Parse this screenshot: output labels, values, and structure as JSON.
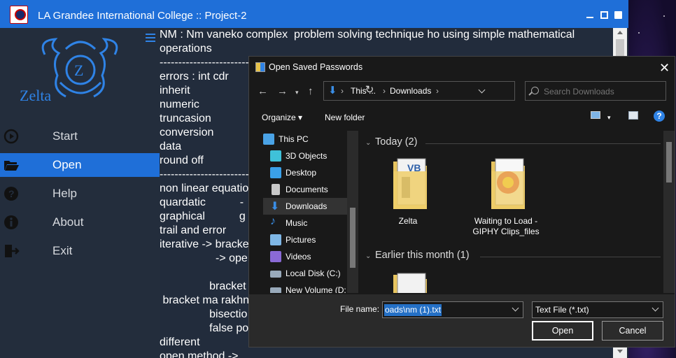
{
  "app": {
    "title": "LA Grandee International College :: Project-2",
    "brand": "Zelta",
    "colors": {
      "accent": "#1f6fd8",
      "sidebar": "#232d3c"
    }
  },
  "sidebar": {
    "items": [
      {
        "label": "Start",
        "icon": "play-circle-icon"
      },
      {
        "label": "Open",
        "icon": "folder-open-icon",
        "active": true
      },
      {
        "label": "Help",
        "icon": "help-circle-icon"
      },
      {
        "label": "About",
        "icon": "info-circle-icon"
      },
      {
        "label": "Exit",
        "icon": "exit-door-icon"
      }
    ]
  },
  "editor": {
    "lines": [
      "NM : Nm vaneko complex  problem solving technique ho using simple mathematical",
      "operations",
      "----------------------------------------",
      "errors : int cdr",
      "inherit",
      "numeric",
      "truncasion",
      "conversion",
      "data",
      "round off",
      "----------------------------------------",
      "non linear equatio",
      "quardatic           -",
      "graphical           g",
      "trail and error",
      "iterative -> bracke",
      "                  -> ope",
      "",
      "                bracket",
      " bracket ma rakhn",
      "                bisectio",
      "                false po",
      "different",
      "open method ->"
    ]
  },
  "dialog": {
    "title": "Open Saved Passwords",
    "breadcrumb": [
      "This ...",
      "Downloads"
    ],
    "search_placeholder": "Search Downloads",
    "organize_label": "Organize",
    "new_folder_label": "New folder",
    "tree": [
      {
        "label": "This PC",
        "icon": "computer-icon",
        "color": "#4aa3e6"
      },
      {
        "label": "3D Objects",
        "icon": "cube-icon",
        "color": "#3fc1d9"
      },
      {
        "label": "Desktop",
        "icon": "desktop-icon",
        "color": "#3aa0e8"
      },
      {
        "label": "Documents",
        "icon": "document-icon",
        "color": "#c8c8c8"
      },
      {
        "label": "Downloads",
        "icon": "download-arrow-icon",
        "color": "#3a8ee6",
        "selected": true
      },
      {
        "label": "Music",
        "icon": "music-note-icon",
        "color": "#3a8ee6"
      },
      {
        "label": "Pictures",
        "icon": "picture-icon",
        "color": "#7fb7e6"
      },
      {
        "label": "Videos",
        "icon": "video-icon",
        "color": "#8a6ad6"
      },
      {
        "label": "Local Disk (C:)",
        "icon": "disk-icon",
        "color": "#9ab"
      },
      {
        "label": "New Volume (D:",
        "icon": "disk-icon",
        "color": "#9ab"
      }
    ],
    "groups": [
      {
        "title": "Today (2)",
        "files": [
          {
            "label": "Zelta",
            "icon": "folder-icon"
          },
          {
            "label": "Waiting to Load - GIPHY Clips_files",
            "icon": "folder-icon"
          }
        ]
      },
      {
        "title": "Earlier this month (1)",
        "files": [
          {
            "label": "",
            "icon": "folder-icon"
          }
        ]
      }
    ],
    "file_name_label": "File name:",
    "file_name_value": "oads\\nm (1).txt",
    "file_type_value": "Text File (*.txt)",
    "open_label": "Open",
    "cancel_label": "Cancel"
  }
}
